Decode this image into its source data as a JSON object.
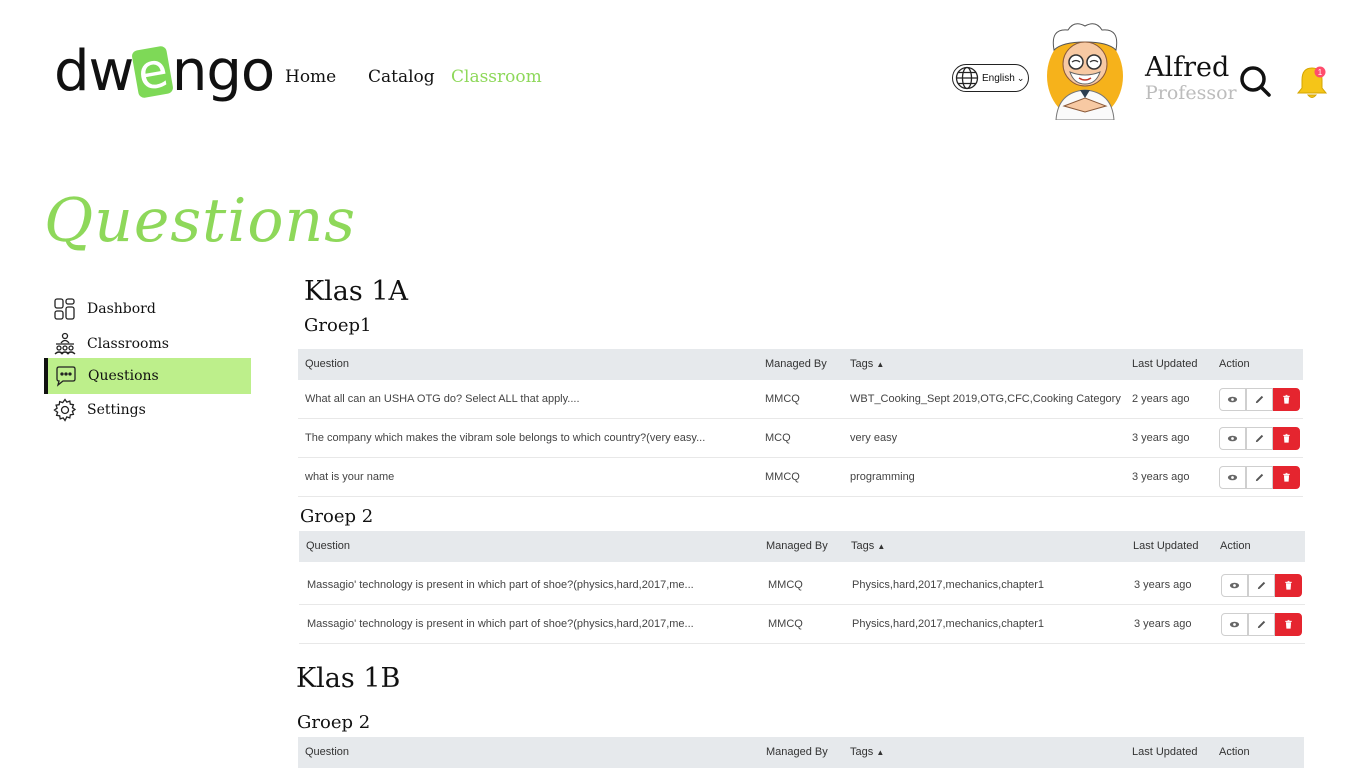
{
  "brand": {
    "logo_left": "dw",
    "logo_e": "e",
    "logo_right": "ngo"
  },
  "nav": {
    "home": "Home",
    "catalog": "Catalog",
    "classroom": "Classroom"
  },
  "language": {
    "label": "English"
  },
  "user": {
    "name": "Alfred",
    "role": "Professor",
    "notification_count": "1"
  },
  "page": {
    "title": "Questions"
  },
  "sidebar": {
    "items": [
      {
        "label": "Dashbord",
        "icon": "dashboard-icon"
      },
      {
        "label": "Classrooms",
        "icon": "classroom-icon"
      },
      {
        "label": "Questions",
        "icon": "questions-icon",
        "active": true
      },
      {
        "label": "Settings",
        "icon": "gear-icon"
      }
    ]
  },
  "columns": {
    "question": "Question",
    "managed_by": "Managed By",
    "tags": "Tags",
    "last_updated": "Last Updated",
    "action": "Action"
  },
  "classes": [
    {
      "name": "Klas 1A",
      "groups": [
        {
          "name": "Groep1",
          "rows": [
            {
              "question": "What all can an USHA OTG do? Select ALL that apply....",
              "managed_by": "MMCQ",
              "tags": "WBT_Cooking_Sept 2019,OTG,CFC,Cooking Category",
              "updated": "2 years ago"
            },
            {
              "question": "The company which makes the vibram sole belongs to which country?(very easy...",
              "managed_by": "MCQ",
              "tags": "very easy",
              "updated": "3 years ago"
            },
            {
              "question": "what is your name",
              "managed_by": "MMCQ",
              "tags": "programming",
              "updated": "3 years ago"
            }
          ]
        },
        {
          "name": "Groep 2",
          "rows": [
            {
              "question": "Massagio' technology is present in which part of shoe?(physics,hard,2017,me...",
              "managed_by": "MMCQ",
              "tags": "Physics,hard,2017,mechanics,chapter1",
              "updated": "3 years ago"
            },
            {
              "question": "Massagio' technology is present in which part of shoe?(physics,hard,2017,me...",
              "managed_by": "MMCQ",
              "tags": "Physics,hard,2017,mechanics,chapter1",
              "updated": "3 years ago"
            }
          ]
        }
      ]
    },
    {
      "name": "Klas 1B",
      "groups": [
        {
          "name": "Groep 2",
          "rows": []
        }
      ]
    }
  ]
}
